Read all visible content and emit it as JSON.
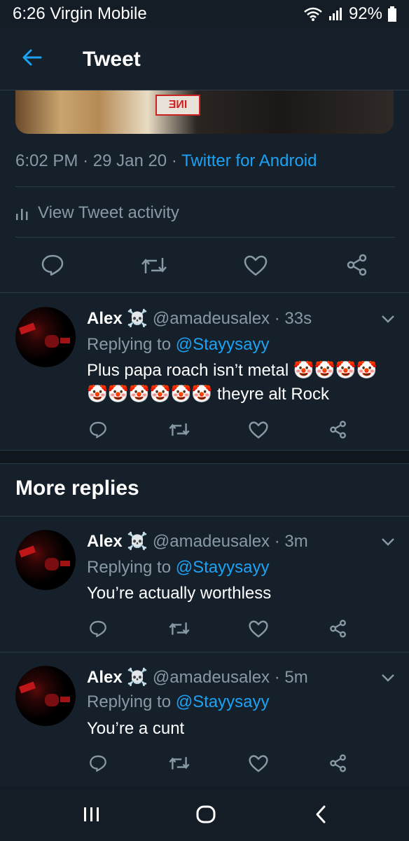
{
  "status_bar": {
    "time_carrier": "6:26 Virgin Mobile",
    "battery": "92%",
    "wifi_icon": "wifi-icon",
    "signal_icon": "signal-icon",
    "battery_icon": "battery-icon"
  },
  "header": {
    "title": "Tweet",
    "back_icon": "back-arrow-icon"
  },
  "main_tweet": {
    "time": "6:02 PM",
    "date": "29 Jan 20",
    "source": "Twitter for Android",
    "sep": "·",
    "activity_label": "View Tweet activity"
  },
  "replies": [
    {
      "name": "Alex ☠️",
      "handle": "@amadeusalex",
      "age": "33s",
      "replying_label": "Replying to",
      "replying_to": "@Stayysayy",
      "text": "Plus papa roach isn’t metal 🤡🤡🤡🤡🤡🤡🤡🤡🤡🤡 theyre alt Rock"
    }
  ],
  "more_replies": {
    "title": "More replies",
    "items": [
      {
        "name": "Alex ☠️",
        "handle": "@amadeusalex",
        "age": "3m",
        "replying_label": "Replying to",
        "replying_to": "@Stayysayy",
        "text": "You’re actually worthless"
      },
      {
        "name": "Alex ☠️",
        "handle": "@amadeusalex",
        "age": "5m",
        "replying_label": "Replying to",
        "replying_to": "@Stayysayy",
        "text": "You’re a cunt"
      }
    ]
  },
  "colors": {
    "background": "#15202b",
    "accent": "#1da1f2",
    "secondary_text": "#8899a6"
  }
}
